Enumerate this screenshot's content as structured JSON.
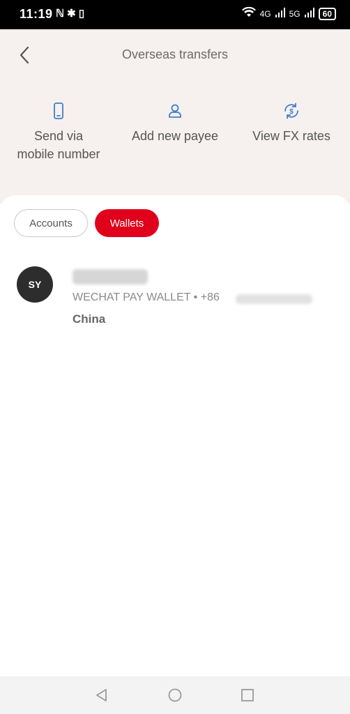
{
  "status_bar": {
    "time": "11:19",
    "left_icons": "ℕ ✱ ▯",
    "signal_1": "4G",
    "signal_2": "5G",
    "battery": "60"
  },
  "header": {
    "title": "Overseas transfers",
    "actions": [
      {
        "label_line1": "Send via",
        "label_line2": "mobile number",
        "icon": "mobile-phone-icon"
      },
      {
        "label_line1": "Add new payee",
        "label_line2": "",
        "icon": "person-icon"
      },
      {
        "label_line1": "View FX rates",
        "label_line2": "",
        "icon": "fx-rates-icon"
      }
    ]
  },
  "tabs": {
    "accounts": "Accounts",
    "wallets": "Wallets",
    "active": "wallets"
  },
  "payees": [
    {
      "initials": "SY",
      "wallet_line": "WECHAT PAY WALLET • +86",
      "country": "China"
    }
  ],
  "colors": {
    "accent": "#e0001b",
    "icon_blue": "#3d7fc9",
    "header_bg": "#f6f0ef"
  }
}
